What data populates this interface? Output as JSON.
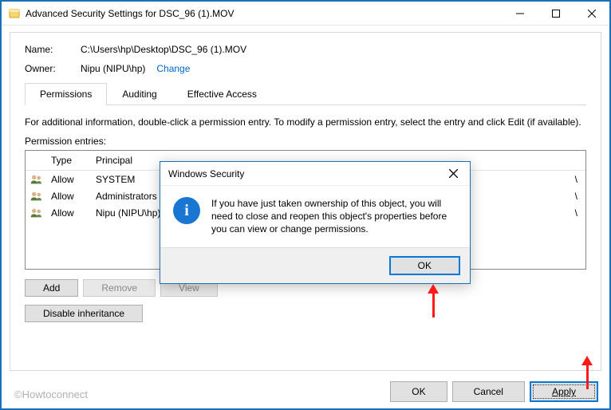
{
  "window": {
    "title": "Advanced Security Settings for DSC_96 (1).MOV"
  },
  "fields": {
    "name_label": "Name:",
    "name_value": "C:\\Users\\hp\\Desktop\\DSC_96 (1).MOV",
    "owner_label": "Owner:",
    "owner_value": "Nipu (NIPU\\hp)",
    "change_link": "Change"
  },
  "tabs": {
    "permissions": "Permissions",
    "auditing": "Auditing",
    "effective": "Effective Access"
  },
  "info_text": "For additional information, double-click a permission entry. To modify a permission entry, select the entry and click Edit (if available).",
  "entries_label": "Permission entries:",
  "table": {
    "hdr_type": "Type",
    "hdr_principal": "Principal",
    "rows": [
      {
        "type": "Allow",
        "principal": "SYSTEM",
        "trail": "\\"
      },
      {
        "type": "Allow",
        "principal": "Administrators (N",
        "trail": "\\"
      },
      {
        "type": "Allow",
        "principal": "Nipu (NIPU\\hp)",
        "trail": "\\"
      }
    ]
  },
  "buttons": {
    "add": "Add",
    "remove": "Remove",
    "view": "View",
    "disable_inheritance": "Disable inheritance",
    "ok": "OK",
    "cancel": "Cancel",
    "apply": "Apply"
  },
  "dialog": {
    "title": "Windows Security",
    "message": "If you have just taken ownership of this object, you will need to close and reopen this object's properties before you can view or change permissions.",
    "ok": "OK"
  },
  "watermark": "©Howtoconnect"
}
